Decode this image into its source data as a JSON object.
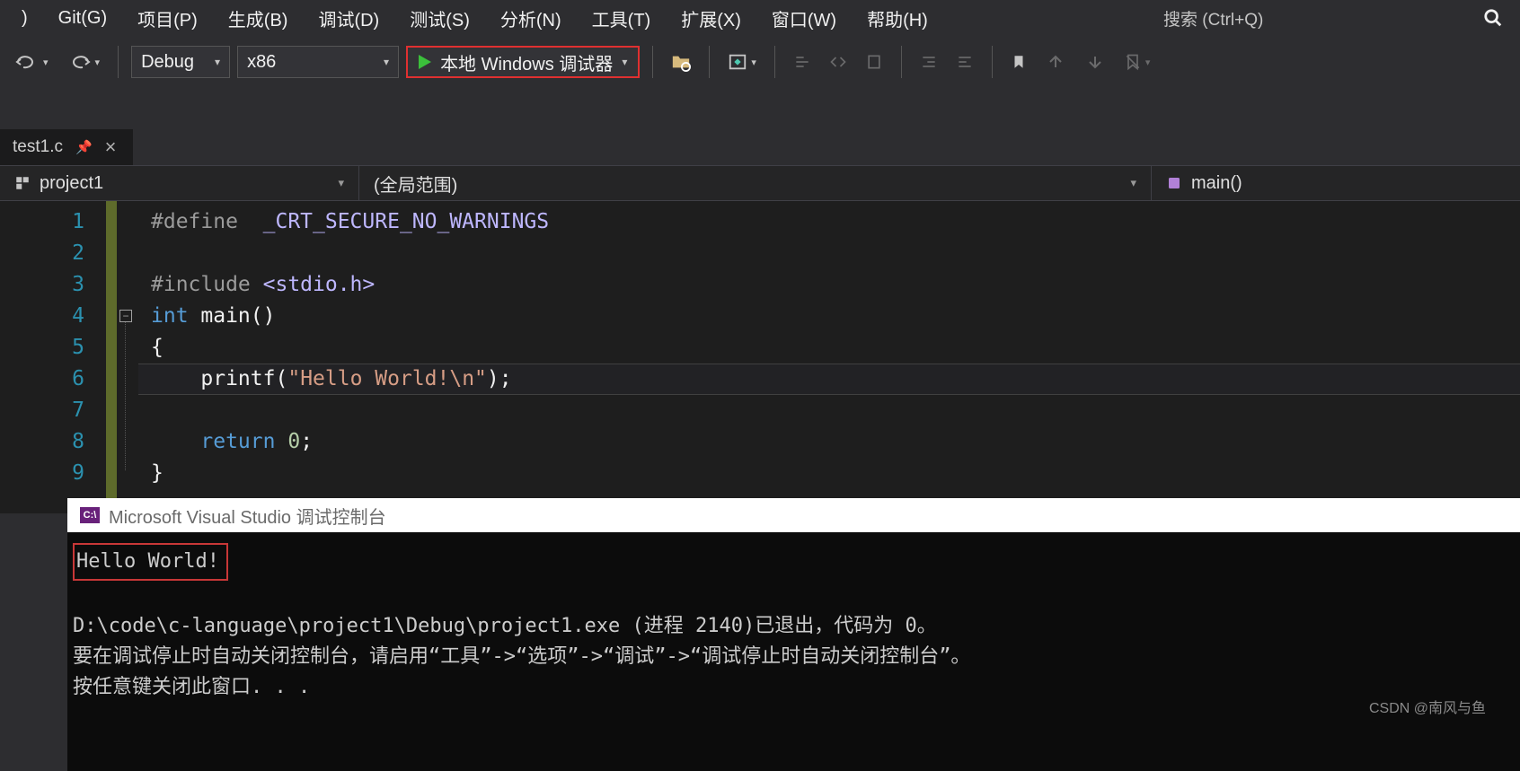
{
  "menu": {
    "items": [
      "Git(G)",
      "项目(P)",
      "生成(B)",
      "调试(D)",
      "测试(S)",
      "分析(N)",
      "工具(T)",
      "扩展(X)",
      "窗口(W)",
      "帮助(H)"
    ],
    "search_placeholder": "搜索 (Ctrl+Q)"
  },
  "toolbar": {
    "config": "Debug",
    "platform": "x86",
    "debug_label": "本地 Windows 调试器"
  },
  "tabs": {
    "active": "test1.c"
  },
  "context": {
    "project": "project1",
    "scope": "(全局范围)",
    "function": "main()"
  },
  "code": {
    "lines": [
      {
        "n": 1,
        "tokens": [
          [
            "pp",
            "#define  "
          ],
          [
            "mac",
            "_CRT_SECURE_NO_WARNINGS"
          ]
        ]
      },
      {
        "n": 2,
        "tokens": []
      },
      {
        "n": 3,
        "tokens": [
          [
            "pp",
            "#include "
          ],
          [
            "mac",
            "<stdio.h>"
          ]
        ]
      },
      {
        "n": 4,
        "tokens": [
          [
            "kw",
            "int "
          ],
          [
            "fn",
            "main"
          ],
          [
            "punc",
            "()"
          ]
        ]
      },
      {
        "n": 5,
        "tokens": [
          [
            "punc",
            "{"
          ]
        ]
      },
      {
        "n": 6,
        "tokens": [
          [
            "punc",
            "    "
          ],
          [
            "fn",
            "printf"
          ],
          [
            "punc",
            "("
          ],
          [
            "str",
            "\"Hello World!\\n\""
          ],
          [
            "punc",
            ");"
          ]
        ]
      },
      {
        "n": 7,
        "tokens": []
      },
      {
        "n": 8,
        "tokens": [
          [
            "punc",
            "    "
          ],
          [
            "kw",
            "return "
          ],
          [
            "num",
            "0"
          ],
          [
            "punc",
            ";"
          ]
        ]
      },
      {
        "n": 9,
        "tokens": [
          [
            "punc",
            "}"
          ]
        ]
      }
    ],
    "highlight_line": 6
  },
  "console": {
    "title": "Microsoft Visual Studio 调试控制台",
    "output_line": "Hello World!",
    "exit_line": "D:\\code\\c-language\\project1\\Debug\\project1.exe (进程 2140)已退出，代码为 0。",
    "hint_line": "要在调试停止时自动关闭控制台，请启用“工具”->“选项”->“调试”->“调试停止时自动关闭控制台”。",
    "press_line": "按任意键关闭此窗口. . ."
  },
  "watermark": "CSDN @南风与鱼"
}
